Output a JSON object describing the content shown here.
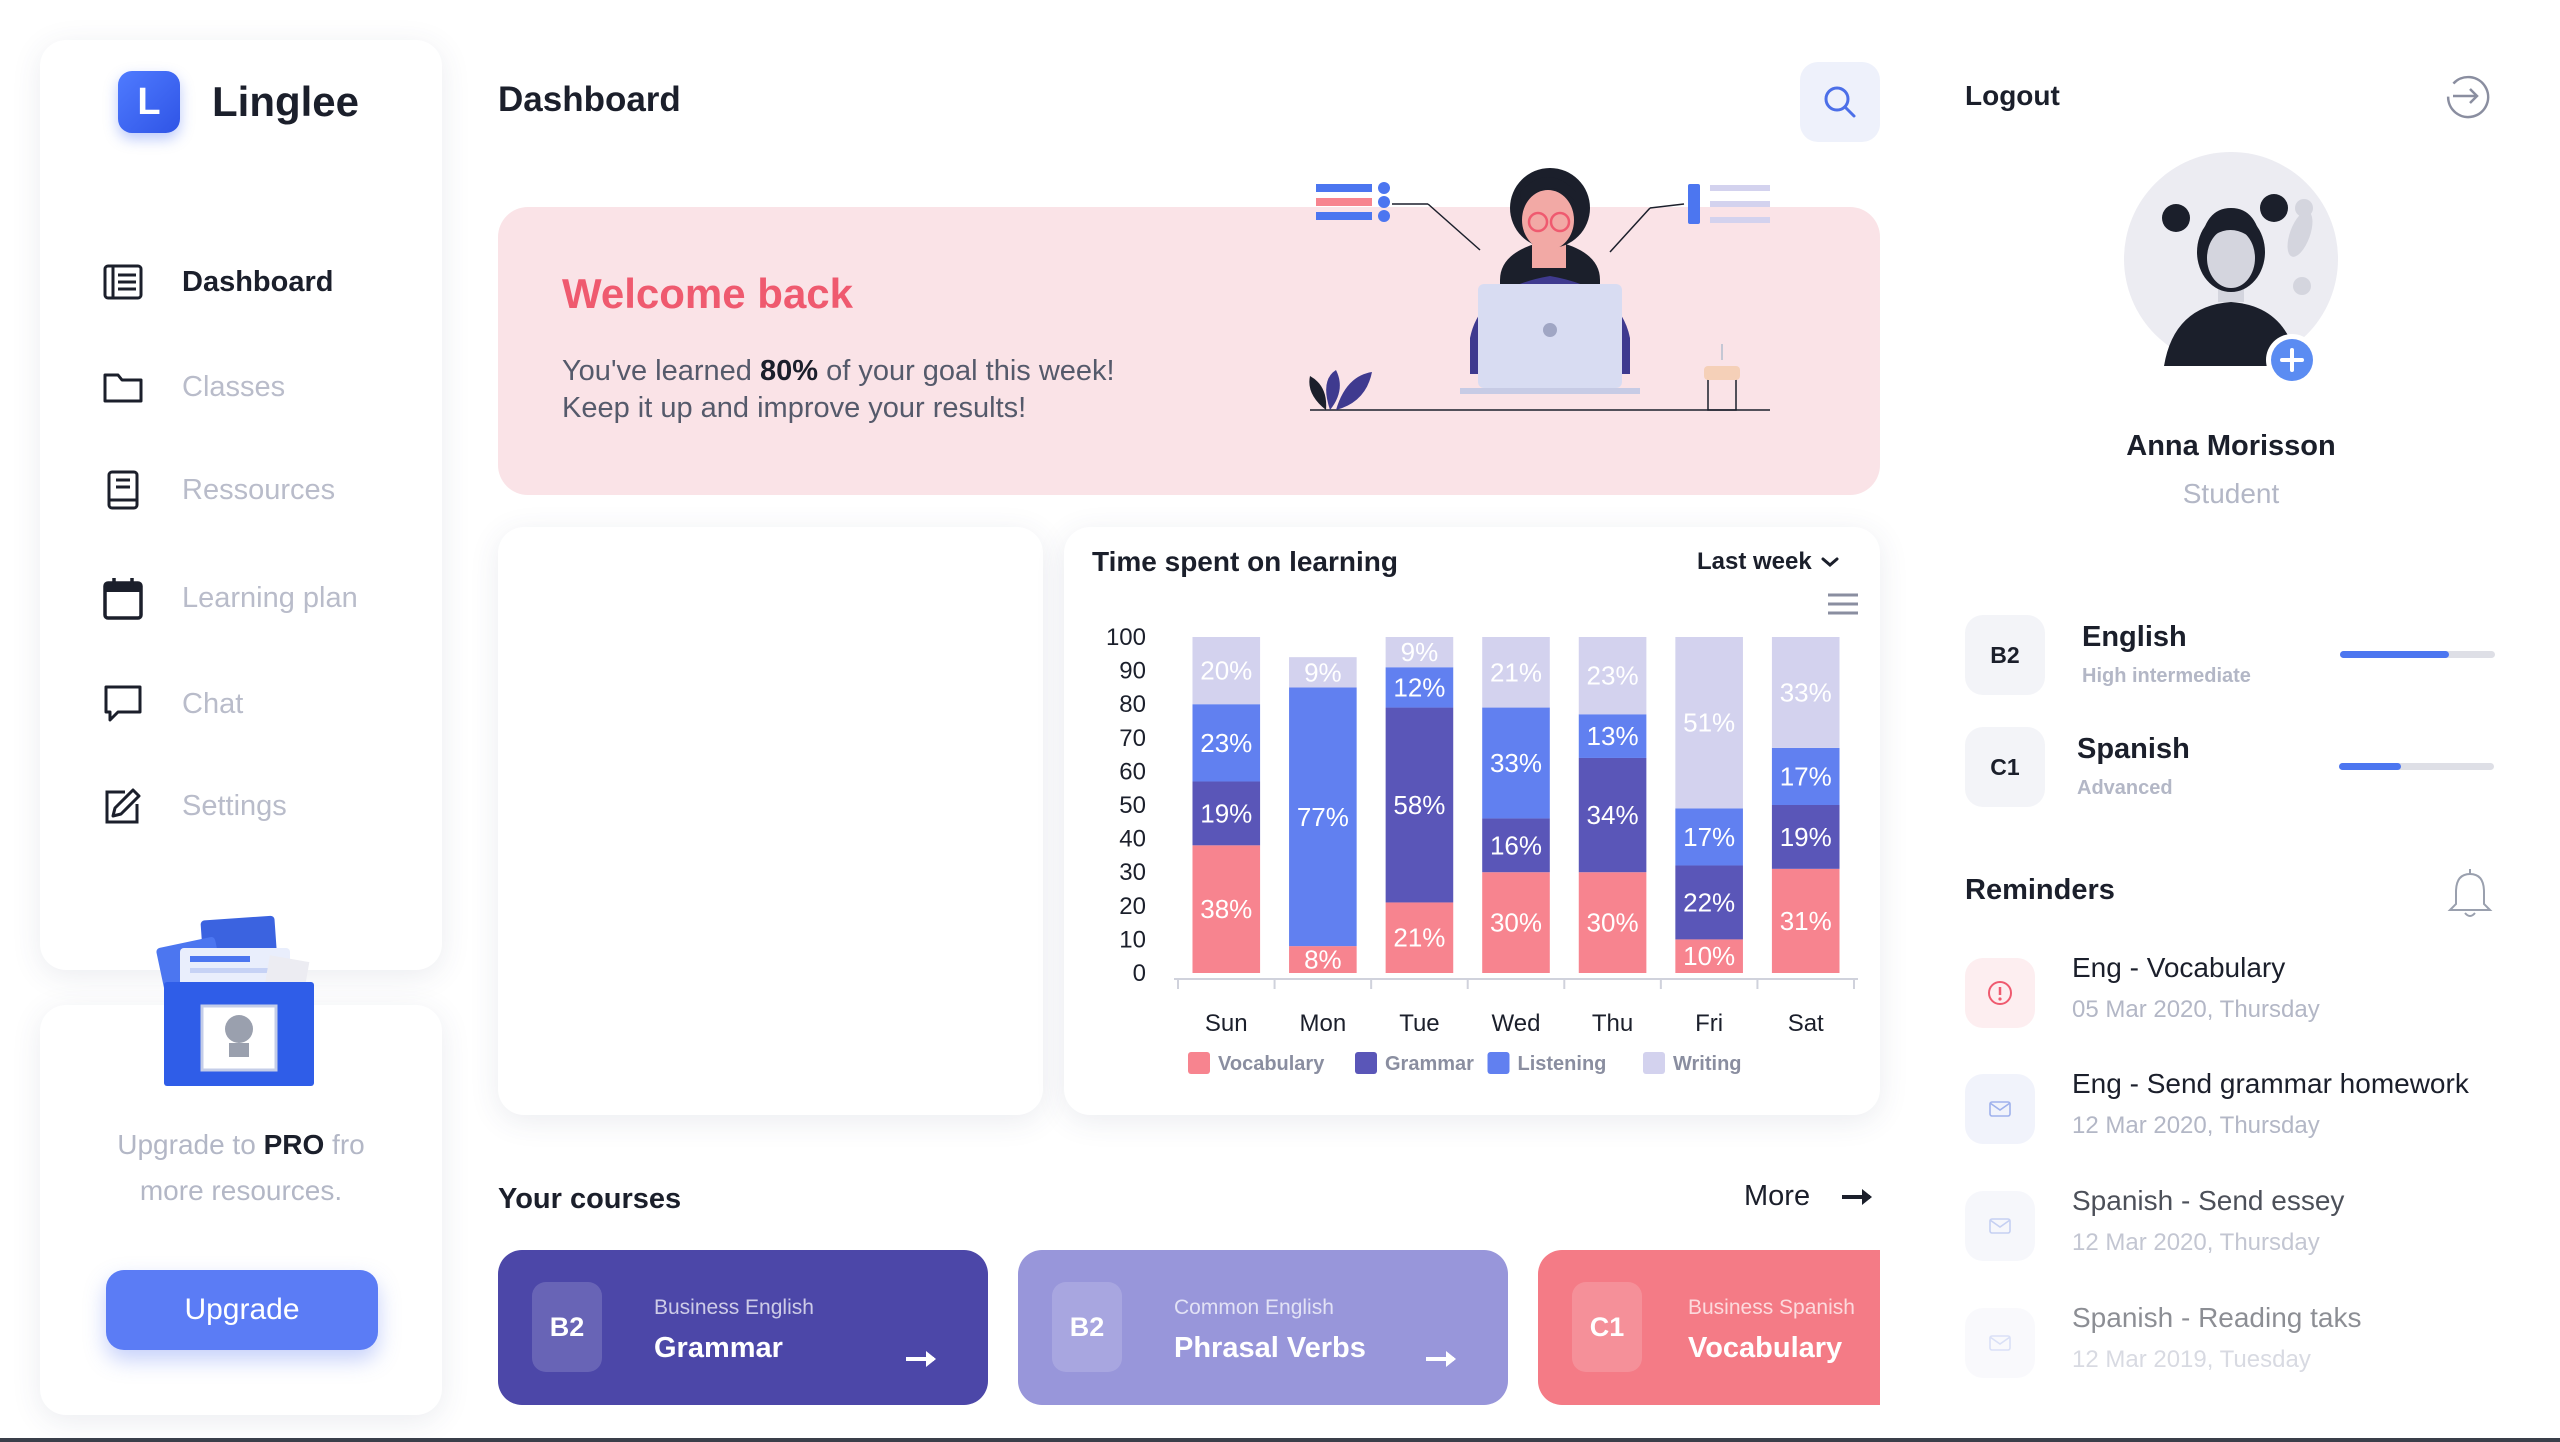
{
  "app": {
    "name": "Linglee",
    "logo_letter": "L"
  },
  "sidebar": {
    "items": [
      {
        "label": "Dashboard",
        "icon": "dashboard-icon",
        "active": true
      },
      {
        "label": "Classes",
        "icon": "folder-icon",
        "active": false
      },
      {
        "label": "Ressources",
        "icon": "book-icon",
        "active": false
      },
      {
        "label": "Learning plan",
        "icon": "calendar-icon",
        "active": false
      },
      {
        "label": "Chat",
        "icon": "chat-icon",
        "active": false
      },
      {
        "label": "Settings",
        "icon": "edit-icon",
        "active": false
      }
    ],
    "upgrade": {
      "text_prefix": "Upgrade to ",
      "text_bold": "PRO",
      "text_suffix": " fro",
      "text_line2": "more resources.",
      "button_label": "Upgrade"
    }
  },
  "header": {
    "title": "Dashboard",
    "search_icon": "search-icon"
  },
  "welcome": {
    "title": "Welcome back",
    "line1_prefix": "You've learned ",
    "line1_bold": "80%",
    "line1_suffix": " of your goal this week!",
    "line2": "Keep it up and improve your results!"
  },
  "chart_panel": {
    "title": "Time spent on learning",
    "range_label": "Last week"
  },
  "chart_data": {
    "type": "bar",
    "stacked": true,
    "categories": [
      "Sun",
      "Mon",
      "Tue",
      "Wed",
      "Thu",
      "Fri",
      "Sat"
    ],
    "series": [
      {
        "name": "Vocabulary",
        "color": "#f7848f",
        "values": [
          38,
          8,
          21,
          30,
          30,
          10,
          31
        ]
      },
      {
        "name": "Grammar",
        "color": "#5a56b8",
        "values": [
          19,
          0,
          58,
          16,
          34,
          22,
          19
        ]
      },
      {
        "name": "Listening",
        "color": "#6180f0",
        "values": [
          23,
          77,
          12,
          33,
          13,
          17,
          17
        ]
      },
      {
        "name": "Writing",
        "color": "#d3d2ee",
        "values": [
          20,
          9,
          9,
          21,
          23,
          51,
          33
        ]
      }
    ],
    "data_labels": "percent",
    "ylim": [
      0,
      100
    ],
    "yticks": [
      0,
      10,
      20,
      30,
      40,
      50,
      60,
      70,
      80,
      90,
      100
    ],
    "legend_position": "bottom"
  },
  "courses": {
    "title": "Your courses",
    "more_label": "More",
    "items": [
      {
        "level": "B2",
        "subtitle": "Business English",
        "name": "Grammar",
        "color": "#4c47a8"
      },
      {
        "level": "B2",
        "subtitle": "Common English",
        "name": "Phrasal Verbs",
        "color": "#9896da"
      },
      {
        "level": "C1",
        "subtitle": "Business Spanish",
        "name": "Vocabulary",
        "color": "#f47b86"
      }
    ]
  },
  "profile": {
    "logout_label": "Logout",
    "name": "Anna Morisson",
    "role": "Student",
    "languages": [
      {
        "level": "B2",
        "name": "English",
        "description": "High intermediate",
        "progress": 0.7
      },
      {
        "level": "C1",
        "name": "Spanish",
        "description": "Advanced",
        "progress": 0.4
      }
    ]
  },
  "reminders": {
    "title": "Reminders",
    "items": [
      {
        "title": "Eng - Vocabulary",
        "date": "05 Mar 2020, Thursday",
        "icon": "alert-icon"
      },
      {
        "title": "Eng - Send grammar homework",
        "date": "12 Mar 2020, Thursday",
        "icon": "mail-icon"
      },
      {
        "title": "Spanish - Send essey",
        "date": "12 Mar 2020, Thursday",
        "icon": "mail-icon"
      },
      {
        "title": "Spanish - Reading taks",
        "date": "12 Mar 2019, Tuesday",
        "icon": "mail-icon"
      }
    ]
  }
}
